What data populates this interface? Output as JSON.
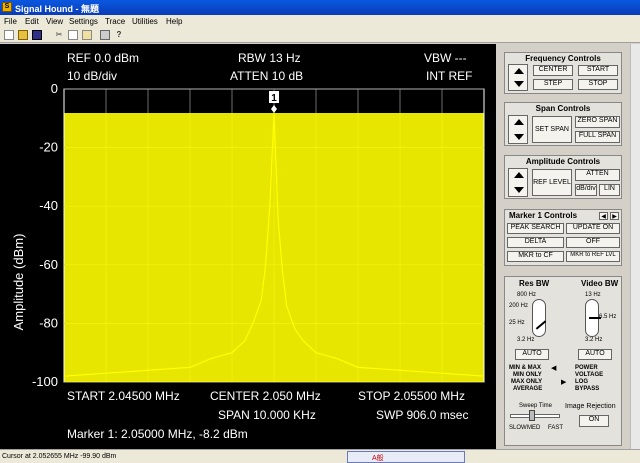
{
  "window": {
    "title": "Signal Hound - 無題"
  },
  "menu": [
    "File",
    "Edit",
    "View",
    "Settings",
    "Trace",
    "Utilities",
    "Help"
  ],
  "plot": {
    "ref": "REF 0.0 dBm",
    "scale": "10 dB/div",
    "rbw": "RBW 13 Hz",
    "atten": "ATTEN 10 dB",
    "vbw": "VBW ---",
    "intref": "INT REF",
    "ylabel": "Amplitude (dBm)",
    "start": "START 2.04500 MHz",
    "center": "CENTER 2.050 MHz",
    "stop": "STOP 2.05500 MHz",
    "span": "SPAN 10.000 KHz",
    "swp": "SWP 906.0 msec",
    "marker_readout": "Marker 1: 2.05000 MHz, -8.2 dBm",
    "marker_label": "1"
  },
  "chart_data": {
    "type": "line",
    "ylim": [
      -100,
      0
    ],
    "xlim": [
      2.045,
      2.055
    ],
    "yticks": [
      "0",
      "-20",
      "-40",
      "-60",
      "-80",
      "-100"
    ],
    "ytick_values": [
      0,
      -20,
      -40,
      -60,
      -80,
      -100
    ],
    "grid": true,
    "trace_color": "#ffff00",
    "marker": {
      "x": 2.05,
      "y": -8.2
    },
    "series": [
      {
        "x": [
          2.045,
          2.046,
          2.047,
          2.048,
          2.0485,
          2.049,
          2.0493,
          2.0495,
          2.0497,
          2.0498,
          2.0499,
          2.05,
          2.0501,
          2.0502,
          2.0503,
          2.0505,
          2.0507,
          2.051,
          2.0515,
          2.052,
          2.053,
          2.054,
          2.055
        ],
        "y": [
          -98,
          -97,
          -96,
          -95,
          -92,
          -90,
          -86,
          -80,
          -72,
          -60,
          -40,
          -8.2,
          -45,
          -62,
          -74,
          -82,
          -86,
          -90,
          -92,
          -95,
          -96,
          -97,
          -98
        ]
      }
    ]
  },
  "panel": {
    "freq": {
      "title": "Frequency Controls",
      "center": "CENTER",
      "start": "START",
      "step": "STEP",
      "stop": "STOP"
    },
    "span": {
      "title": "Span Controls",
      "set": "SET SPAN",
      "zero": "ZERO SPAN",
      "full": "FULL SPAN"
    },
    "amp": {
      "title": "Amplitude Controls",
      "ref": "REF LEVEL",
      "atten": "ATTEN",
      "dbdiv": "dB/div",
      "lin": "LIN"
    },
    "marker": {
      "title": "Marker 1 Controls",
      "peak": "PEAK SEARCH",
      "update": "UPDATE ON",
      "delta": "DELTA",
      "off": "OFF",
      "mkrcf": "MKR to CF",
      "mkrref": "MKR to REF LVL"
    },
    "res": {
      "title": "Res BW",
      "t1": "800 Hz",
      "t2": "200 Hz",
      "t3": "25 Hz",
      "t4": "3.2 Hz",
      "auto": "AUTO"
    },
    "video": {
      "title": "Video BW",
      "t1": "13 Hz",
      "t2": "6.5 Hz",
      "t3": "3.2 Hz",
      "auto": "AUTO"
    },
    "mode": {
      "a": "MIN & MAX",
      "b": "MIN ONLY",
      "c": "MAX ONLY",
      "d": "AVERAGE",
      "e": "POWER",
      "f": "VOLTAGE",
      "g": "LOG",
      "h": "BYPASS"
    },
    "sweep": {
      "title": "Sweep Time",
      "slow": "SLOW",
      "med": "MED",
      "fast": "FAST"
    },
    "image": {
      "title": "Image Rejection",
      "on": "ON"
    }
  },
  "status": {
    "text": "Cursor at 2.052655 MHz  -99.90 dBm",
    "ime": "A般"
  }
}
